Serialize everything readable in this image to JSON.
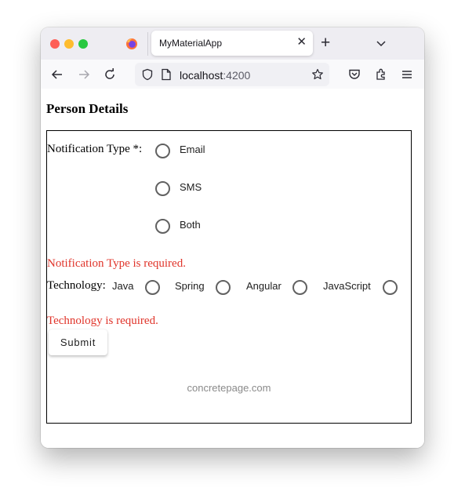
{
  "browser": {
    "tab_title": "MyMaterialApp",
    "url_host": "localhost",
    "url_port": ":4200"
  },
  "page": {
    "title": "Person Details",
    "notification": {
      "label": "Notification Type *:",
      "options": [
        "Email",
        "SMS",
        "Both"
      ],
      "error": "Notification Type is required."
    },
    "technology": {
      "label": "Technology:",
      "options": [
        "Java",
        "Spring",
        "Angular",
        "JavaScript"
      ],
      "error": "Technology is required."
    },
    "submit_label": "Submit",
    "footer": "concretepage.com"
  },
  "colors": {
    "error": "#e0342a",
    "radio_border": "#616161",
    "traffic_red": "#fe5f57",
    "traffic_yellow": "#febc2e",
    "traffic_green": "#28c840"
  }
}
